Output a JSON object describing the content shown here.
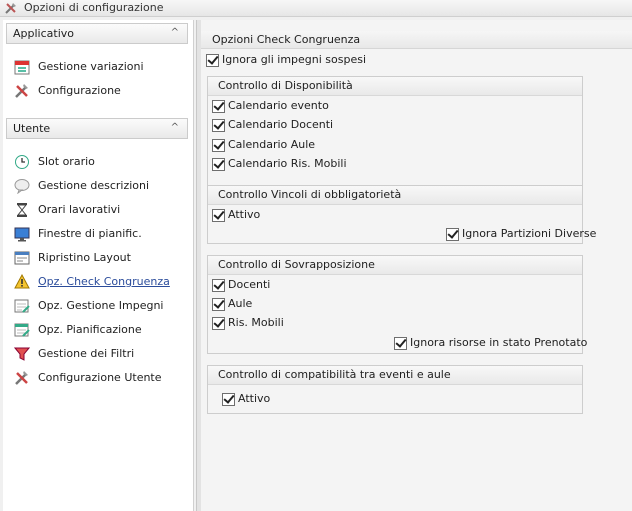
{
  "window": {
    "title": "Opzioni di configurazione"
  },
  "sidebar": {
    "groups": [
      {
        "label": "Applicativo",
        "items": [
          {
            "label": "Gestione variazioni",
            "icon": "calendar-icon"
          },
          {
            "label": "Configurazione",
            "icon": "tools-icon"
          }
        ]
      },
      {
        "label": "Utente",
        "items": [
          {
            "label": "Slot orario",
            "icon": "clock-icon"
          },
          {
            "label": "Gestione descrizioni",
            "icon": "speech-bubble-icon"
          },
          {
            "label": "Orari lavorativi",
            "icon": "hourglass-icon"
          },
          {
            "label": "Finestre di pianific.",
            "icon": "monitor-icon"
          },
          {
            "label": "Ripristino Layout",
            "icon": "window-layout-icon"
          },
          {
            "label": "Opz. Check Congruenza",
            "icon": "warning-icon",
            "active": true
          },
          {
            "label": "Opz. Gestione Impegni",
            "icon": "schedule-edit-icon"
          },
          {
            "label": "Opz. Pianificazione",
            "icon": "schedule-edit-icon"
          },
          {
            "label": "Gestione dei Filtri",
            "icon": "filter-icon"
          },
          {
            "label": "Configurazione Utente",
            "icon": "tools-icon"
          }
        ]
      }
    ]
  },
  "main": {
    "header": "Opzioni Check Congruenza",
    "ignora_impegni_sospesi": {
      "label": "Ignora gli impegni sospesi",
      "checked": true
    },
    "disponibilita": {
      "title": "Controllo di Disponibilità",
      "options": [
        {
          "label": "Calendario evento",
          "checked": true
        },
        {
          "label": "Calendario Docenti",
          "checked": true
        },
        {
          "label": "Calendario Aule",
          "checked": true
        },
        {
          "label": "Calendario Ris. Mobili",
          "checked": true
        }
      ]
    },
    "vincoli": {
      "title": "Controllo Vincoli di obbligatorietà",
      "attivo": {
        "label": "Attivo",
        "checked": true
      },
      "ignora_partizioni": {
        "label": "Ignora Partizioni Diverse",
        "checked": true
      }
    },
    "sovrapposizione": {
      "title": "Controllo di Sovrapposizione",
      "options": [
        {
          "label": "Docenti",
          "checked": true
        },
        {
          "label": "Aule",
          "checked": true
        },
        {
          "label": "Ris. Mobili",
          "checked": true
        }
      ],
      "ignora_prenotato": {
        "label": "Ignora risorse in stato Prenotato",
        "checked": true
      }
    },
    "compatibilita": {
      "title": "Controllo di compatibilità tra eventi e aule",
      "attivo": {
        "label": "Attivo",
        "checked": true
      }
    }
  }
}
